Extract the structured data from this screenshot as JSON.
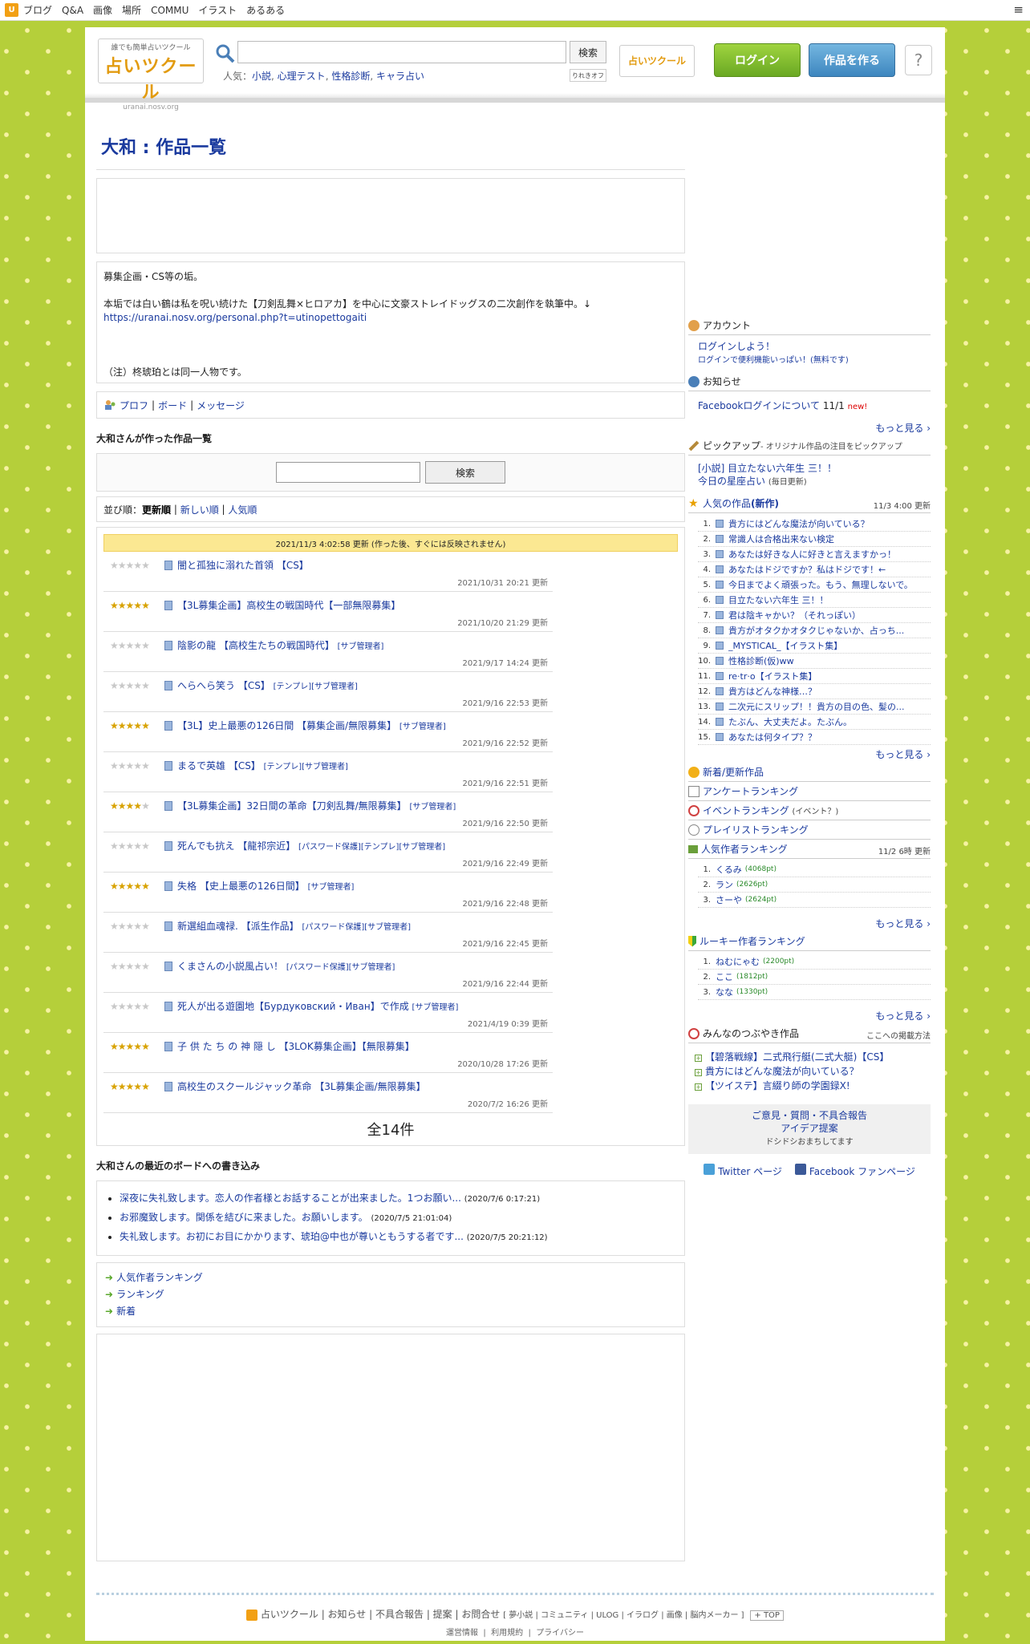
{
  "topnav": {
    "logo": "U",
    "items": [
      "ブログ",
      "Q&A",
      "画像",
      "場所",
      "COMMU",
      "イラスト",
      "あるある"
    ],
    "menu_icon": "≡"
  },
  "header": {
    "logo_top": "誰でも簡単占いツクール",
    "logo_main": "占いツクール",
    "logo_sub": "uranai.nosv.org",
    "search_button": "検索",
    "popular_label": "人気：",
    "popular_links": [
      "小説",
      "心理テスト",
      "性格診断",
      "キャラ占い"
    ],
    "rireki": "りれきオフ",
    "small_logo": "占いツクール",
    "login_button": "ログイン",
    "make_button": "作品を作る",
    "help_icon": "?"
  },
  "main": {
    "title": "大和 : 作品一覧",
    "profile": {
      "line1": "募集企画・CS等の垢。",
      "line2": "本垢では白い鶴は私を呪い続けた【刀剣乱舞×ヒロアカ】を中心に文豪ストレイドッグスの二次創作を執筆中。↓",
      "link": "https://uranai.nosv.org/personal.php?t=utinopettogaiti",
      "line3": "（注）柊琥珀とは同一人物です。"
    },
    "profile_links": [
      "プロフ",
      "ボード",
      "メッセージ"
    ],
    "works_heading": "大和さんが作った作品一覧",
    "works_search_button": "検索",
    "sort": {
      "label": "並び順：",
      "active": "更新順",
      "opt1": "新しい順",
      "opt2": "人気順"
    },
    "update_notice": "2021/11/3 4:02:58 更新 (作った後、すぐには反映されません)",
    "works": [
      {
        "title": "闇と孤独に溺れた首領 【CS】",
        "tags": "",
        "date": "2021/10/31 20:21 更新",
        "stars": 0
      },
      {
        "title": "【3L募集企画】高校生の戦国時代【一部無限募集】",
        "tags": "",
        "date": "2021/10/20 21:29 更新",
        "stars": 4.5
      },
      {
        "title": "陰影の龍 【高校生たちの戦国時代】",
        "tags": "[サブ管理者]",
        "date": "2021/9/17 14:24 更新",
        "stars": 0
      },
      {
        "title": "へらへら笑う 【CS】",
        "tags": "[テンプレ][サブ管理者]",
        "date": "2021/9/16 22:53 更新",
        "stars": 0
      },
      {
        "title": "【3L】史上最悪の126日間 【募集企画/無限募集】",
        "tags": "[サブ管理者]",
        "date": "2021/9/16 22:52 更新",
        "stars": 4.5
      },
      {
        "title": "まるで英雄 【CS】",
        "tags": "[テンプレ][サブ管理者]",
        "date": "2021/9/16 22:51 更新",
        "stars": 0
      },
      {
        "title": "【3L募集企画】32日間の革命【刀剣乱舞/無限募集】",
        "tags": "[サブ管理者]",
        "date": "2021/9/16 22:50 更新",
        "stars": 3.5
      },
      {
        "title": "死んでも抗え 【龍祁宗近】",
        "tags": "[パスワード保護][テンプレ][サブ管理者]",
        "date": "2021/9/16 22:49 更新",
        "stars": 0
      },
      {
        "title": "失格 【史上最悪の126日間】",
        "tags": "[サブ管理者]",
        "date": "2021/9/16 22:48 更新",
        "stars": 4.5
      },
      {
        "title": "新選組血魂禄. 【派生作品】",
        "tags": "[パスワード保護][サブ管理者]",
        "date": "2021/9/16 22:45 更新",
        "stars": 0
      },
      {
        "title": "くまさんの小説風占い！",
        "tags": "[パスワード保護][サブ管理者]",
        "date": "2021/9/16 22:44 更新",
        "stars": 0
      },
      {
        "title": "死人が出る遊園地【Бурдуковский・Иван】で作成",
        "tags": "[サブ管理者]",
        "date": "2021/4/19 0:39 更新",
        "stars": 0
      },
      {
        "title": "子 供 た ち の 神 隠 し 【3LOK募集企画】【無限募集】",
        "tags": "",
        "date": "2020/10/28 17:26 更新",
        "stars": 5
      },
      {
        "title": "高校生のスクールジャック革命 【3L募集企画/無限募集】",
        "tags": "",
        "date": "2020/7/2 16:26 更新",
        "stars": 5
      }
    ],
    "total": "全14件",
    "board_heading": "大和さんの最近のボードへの書き込み",
    "board": [
      {
        "text": "深夜に失礼致します。恋人の作者様とお話することが出来ました。1つお願い...",
        "date": "(2020/7/6 0:17:21)"
      },
      {
        "text": "お邪魔致します。関係を結びに来ました。お願いします。",
        "date": "(2020/7/5 21:01:04)"
      },
      {
        "text": "失礼致します。お初にお目にかかります、琥珀@中也が尊いともうする者です...",
        "date": "(2020/7/5 20:21:12)"
      }
    ],
    "nav_links": [
      "人気作者ランキング",
      "ランキング",
      "新着"
    ]
  },
  "side": {
    "account_title": "アカウント",
    "login_prompt": "ログインしよう！",
    "login_sub": "ログインで便利機能いっぱい！(無料です)",
    "news_title": "お知らせ",
    "news_item": "Facebookログインについて",
    "news_date": "11/1",
    "news_new": "new!",
    "more": "もっと見る ›",
    "pickup_title": "ピックアップ",
    "pickup_sub": "- オリジナル作品の注目をピックアップ",
    "pickup1": "[小説] 目立たない六年生 三！！",
    "pickup2": "今日の星座占い",
    "pickup2_sub": "(毎日更新)",
    "popular_title": "人気の作品",
    "popular_new": "(新作)",
    "popular_time": "11/3 4:00 更新",
    "popular_items": [
      "貴方にはどんな魔法が向いている？",
      "常識人は合格出来ない検定",
      "あなたは好きな人に好きと言えますかっ！",
      "あなたはドジですか？私はドジです！←",
      "今日までよく頑張った。もう、無理しないで。",
      "目立たない六年生 三！！",
      "君は陰キャかい？（それっぽい）",
      "貴方がオタクかオタクじゃないか、占っち...",
      "_MYSTICAL_【イラスト集】",
      "性格診断(仮)ww",
      "re·tr·o【イラスト集】",
      "貴方はどんな神様…？",
      "二次元にスリップ！！貴方の目の色、髪の...",
      "たぶん、大丈夫だよ。たぶん。",
      "あなたは何タイプ？？"
    ],
    "new_works": "新着/更新作品",
    "survey_rank": "アンケートランキング",
    "event_rank": "イベントランキング",
    "event_q": "(イベント？)",
    "playlist_rank": "プレイリストランキング",
    "author_rank_title": "人気作者ランキング",
    "author_rank_time": "11/2 6時 更新",
    "author_rank": [
      {
        "name": "くるみ",
        "pt": "(4068pt)"
      },
      {
        "name": "ラン",
        "pt": "(2626pt)"
      },
      {
        "name": "さーや",
        "pt": "(2624pt)"
      }
    ],
    "rookie_title": "ルーキー作者ランキング",
    "rookie_rank": [
      {
        "name": "ねむにゃむ",
        "pt": "(2200pt)"
      },
      {
        "name": "ここ",
        "pt": "(1812pt)"
      },
      {
        "name": "なな",
        "pt": "(1330pt)"
      }
    ],
    "tsubu_title": "みんなのつぶやき作品",
    "tsubu_link": "ここへの掲載方法",
    "tsubu_items": [
      "【碧落戦線】二式飛行艇(二式大艇)【CS】",
      "貴方にはどんな魔法が向いている？",
      "【ツイステ】言綴り師の学園録X!"
    ],
    "opinion1": "ご意見・質問・不具合報告",
    "opinion2": "アイデア提案",
    "opinion3": "ドシドシおまちしてます",
    "twitter": "Twitter ページ",
    "facebook": "Facebook ファンページ"
  },
  "footer": {
    "links": [
      "占いツクール",
      "お知らせ",
      "不具合報告",
      "提案",
      "お問合せ"
    ],
    "sub": "[ 夢小説 | コミュニティ | ULOG | イラログ | 画像 | 脳内メーカー ]",
    "top": "+ TOP",
    "links2": [
      "運営情報",
      "利用規約",
      "プライバシー"
    ]
  }
}
